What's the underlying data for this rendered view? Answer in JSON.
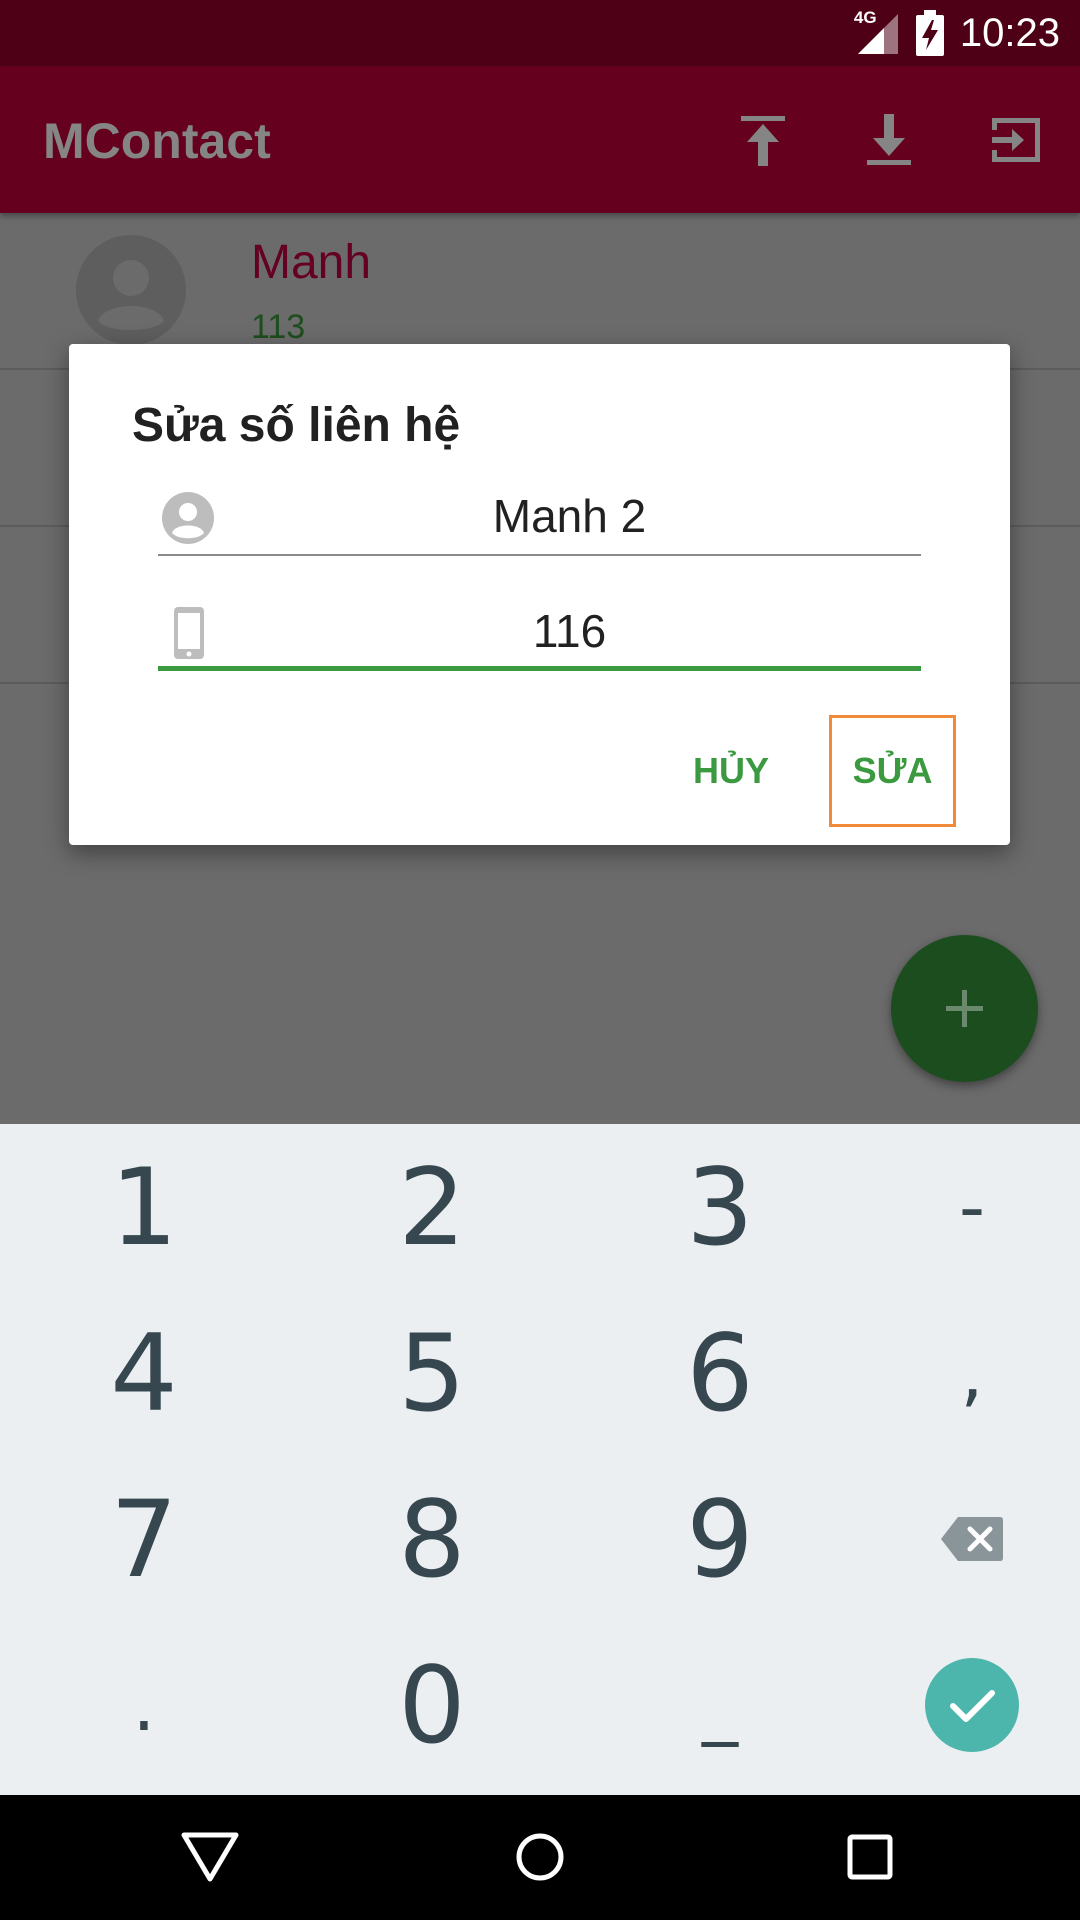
{
  "status_bar": {
    "time": "10:23",
    "network": "4G"
  },
  "app_bar": {
    "title": "MContact",
    "actions": [
      {
        "icon": "upload-icon"
      },
      {
        "icon": "download-icon"
      },
      {
        "icon": "logout-icon"
      }
    ]
  },
  "contacts": [
    {
      "name": "Manh",
      "phone": "113"
    }
  ],
  "dialog": {
    "title": "Sửa số liên hệ",
    "name_value": "Manh 2",
    "phone_value": "116",
    "cancel_label": "HỦY",
    "edit_label": "SỬA"
  },
  "keyboard": {
    "rows": [
      [
        "1",
        "2",
        "3",
        "-"
      ],
      [
        "4",
        "5",
        "6",
        ","
      ],
      [
        "7",
        "8",
        "9",
        "backspace"
      ],
      [
        ".",
        "0",
        "_",
        "done"
      ]
    ]
  },
  "colors": {
    "app_bar": "#65001f",
    "status_bar": "#4e0017",
    "accent_green": "#3b9a3f",
    "highlight_orange": "#f18b3a",
    "done_key": "#4db6ac"
  }
}
